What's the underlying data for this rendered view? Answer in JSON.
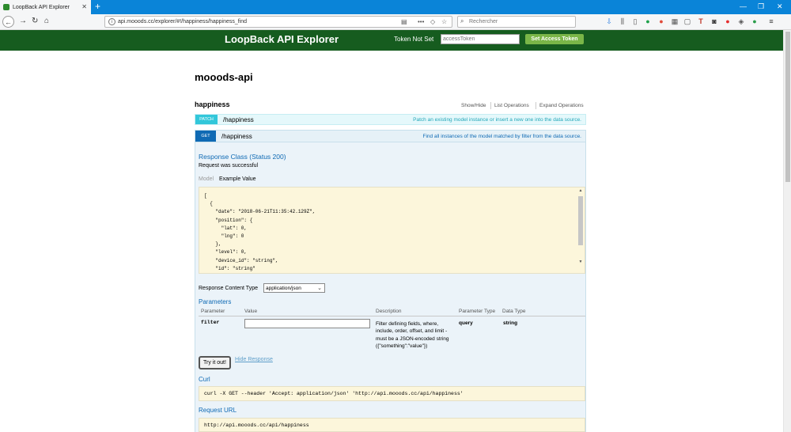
{
  "browser": {
    "tab_title": "LoopBack API Explorer",
    "url": "api.mooods.cc/explorer/#!/happiness/happiness_find",
    "search_placeholder": "Rechercher"
  },
  "header": {
    "brand": "LoopBack API Explorer",
    "token_status": "Token Not Set",
    "token_placeholder": "accessToken",
    "set_token_label": "Set Access Token"
  },
  "api": {
    "title": "mooods-api",
    "resource": "happiness",
    "resource_ops": [
      "Show/Hide",
      "List Operations",
      "Expand Operations"
    ]
  },
  "operations": [
    {
      "method": "PATCH",
      "path": "/happiness",
      "description": "Patch an existing model instance or insert a new one into the data source."
    },
    {
      "method": "GET",
      "path": "/happiness",
      "description": "Find all instances of the model matched by filter from the data source."
    }
  ],
  "detail": {
    "response_class": "Response Class (Status 200)",
    "response_msg": "Request was successful",
    "tab_model": "Model",
    "tab_example": "Example Value",
    "example_code": "[\n  {\n    \"date\": \"2018-06-21T11:35:42.129Z\",\n    \"position\": {\n      \"lat\": 0,\n      \"lng\": 0\n    },\n    \"level\": 0,\n    \"device_id\": \"string\",\n    \"id\": \"string\"",
    "content_type_label": "Response Content Type",
    "content_type_value": "application/json",
    "parameters_heading": "Parameters",
    "param_columns": [
      "Parameter",
      "Value",
      "Description",
      "Parameter Type",
      "Data Type"
    ],
    "param": {
      "name": "filter",
      "value": "",
      "description": "Filter defining fields, where, include, order, offset, and limit - must be a JSON-encoded string ({\"something\":\"value\"})",
      "param_type": "query",
      "data_type": "string"
    },
    "try_label": "Try it out!",
    "hide_response_label": "Hide Response",
    "curl_heading": "Curl",
    "curl_cmd": "curl -X GET --header 'Accept: application/json' 'http://api.mooods.cc/api/happiness'",
    "request_url_heading": "Request URL",
    "request_url": "http://api.mooods.cc/api/happiness"
  },
  "colors": {
    "header_green": "#165c1f",
    "get_blue": "#0f6ab4",
    "patch_cyan": "#32c7da",
    "token_button": "#7ab648"
  }
}
